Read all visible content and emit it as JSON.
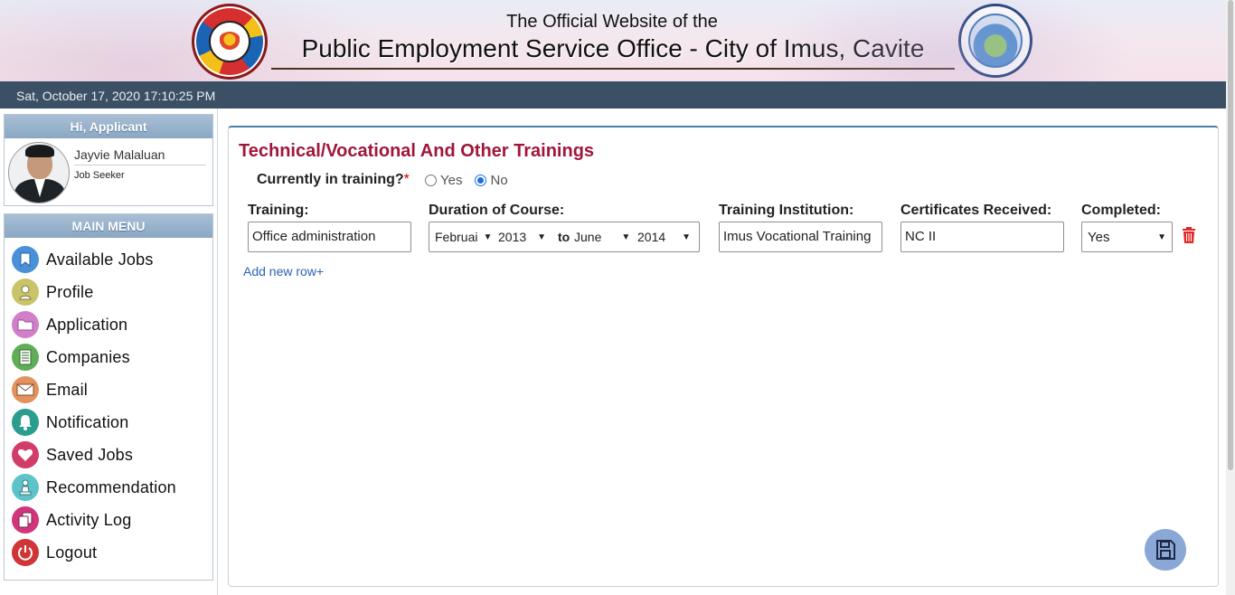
{
  "header": {
    "subtitle": "The Official Website of the",
    "title": "Public Employment Service Office - City of Imus, Cavite",
    "logo_left_text": "PUBLIC EMPLOYMENT SERVICE OFFICE P.E.S.O.",
    "logo_right_text": "LUNGSOD NG IMUS LALAWIGAN NG CAVITE 2012"
  },
  "datebar": {
    "datetime": "Sat, October 17, 2020 17:10:25 PM"
  },
  "sidebar": {
    "greeting": "Hi, Applicant",
    "user_name": "Jayvie Malaluan",
    "user_role": "Job Seeker",
    "menu_title": "MAIN MENU",
    "items": [
      {
        "label": "Available Jobs",
        "icon": "bookmark-icon",
        "color": "#4a90d9"
      },
      {
        "label": "Profile",
        "icon": "user-icon",
        "color": "#c9c46a"
      },
      {
        "label": "Application",
        "icon": "folder-icon",
        "color": "#d27fc9"
      },
      {
        "label": "Companies",
        "icon": "building-icon",
        "color": "#5fae57"
      },
      {
        "label": "Email",
        "icon": "envelope-icon",
        "color": "#e3925e"
      },
      {
        "label": "Notification",
        "icon": "bell-icon",
        "color": "#2a9d8f"
      },
      {
        "label": "Saved Jobs",
        "icon": "heart-icon",
        "color": "#d13c68"
      },
      {
        "label": "Recommendation",
        "icon": "pawn-icon",
        "color": "#5ec3c9"
      },
      {
        "label": "Activity Log",
        "icon": "copy-icon",
        "color": "#d1357c"
      },
      {
        "label": "Logout",
        "icon": "power-icon",
        "color": "#d13535"
      }
    ]
  },
  "main": {
    "section_title": "Technical/Vocational And Other Trainings",
    "question": "Currently in training?",
    "required_mark": "*",
    "radio_yes": "Yes",
    "radio_no": "No",
    "radio_selected": "No",
    "labels": {
      "training": "Training:",
      "duration": "Duration of Course:",
      "institution": "Training Institution:",
      "certificates": "Certificates Received:",
      "completed": "Completed:"
    },
    "row": {
      "training": "Office administration",
      "from_month": "Februai",
      "from_year": "2013",
      "to_text": "to",
      "to_month": "June",
      "to_year": "2014",
      "institution": "Imus Vocational Training",
      "certificates": "NC II",
      "completed": "Yes"
    },
    "add_row": "Add new row+"
  }
}
